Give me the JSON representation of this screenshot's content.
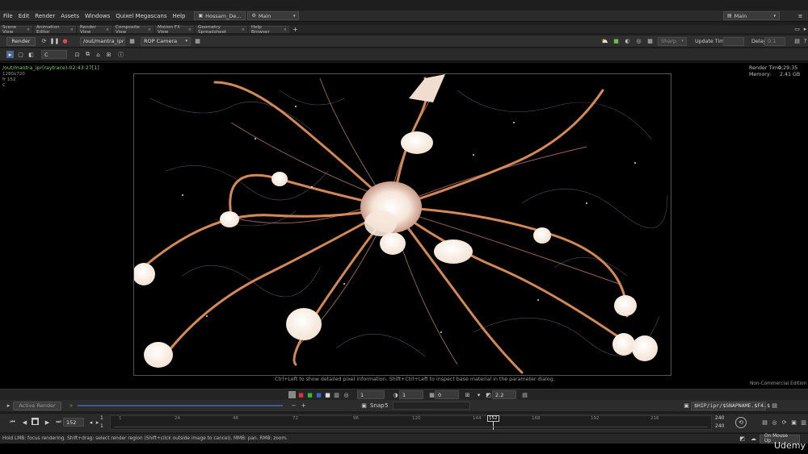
{
  "menu": [
    "File",
    "Edit",
    "Render",
    "Assets",
    "Windows",
    "Quixel Megascans",
    "Help"
  ],
  "desktop": {
    "file_name": "Hossam_De...",
    "desktop_name": "Main",
    "right_desktop": "Main"
  },
  "pane_tabs": [
    {
      "label": "Scene View",
      "active": false
    },
    {
      "label": "Animation Editor",
      "active": false
    },
    {
      "label": "Render View",
      "active": false
    },
    {
      "label": "Composite View",
      "active": false
    },
    {
      "label": "Motion FX View",
      "active": false
    },
    {
      "label": "Geometry Spreadsheet",
      "active": false
    },
    {
      "label": "Help Browser",
      "active": false
    }
  ],
  "render_toolbar": {
    "render_label": "Render",
    "rop_path": "/out/mantra_ipr",
    "camera": "ROP Camera",
    "sharp": "Sharp",
    "update_time": "Update Time",
    "delay": "Delay",
    "delay_value": "0.1"
  },
  "sub_toolbar": {
    "channel": "C"
  },
  "viewport": {
    "render_path": "/out/mantra_ipr(raytrace)-02:43:27[1]",
    "resolution": "1280x720",
    "frame_info": "fr 152",
    "channel_info": "C",
    "render_time_label": "Render Time:",
    "render_time": "0:29:35",
    "memory_label": "Memory:",
    "memory": "2.41 GB",
    "hint": "Ctrl+Left to show detailed pixel information. Shift+Ctrl+Left to inspect base material in the parameter dialog.",
    "edition": "Non-Commercial Edition"
  },
  "view_controls": {
    "field1": "1",
    "field2": "1",
    "field3": "0",
    "gamma": "2.2"
  },
  "status": {
    "active_render": "Active Render",
    "snap_label": "Snap",
    "snap_value": "5",
    "output_path": "$HIP/ipr/$SNAPNAME.$F4.$"
  },
  "timeline": {
    "current_frame": "152",
    "start": "1",
    "start2": "1",
    "ticks": [
      "1",
      "24",
      "48",
      "72",
      "96",
      "120",
      "144",
      "152",
      "168",
      "192",
      "216",
      "240"
    ],
    "end": "240",
    "end2": "240"
  },
  "help": "Hold LMB: focus rendering. Shift+drag: select render region (Shift+click outside image to cancel). MMB: pan. RMB: zoom.",
  "mouse_mode": "On Mouse Up",
  "watermark": "Udemy",
  "colors": {
    "accent_green": "#8fd35a",
    "timeline_bar": "#3a5a9a",
    "neuron_glow": "#fff4e8",
    "dendrite_orange": "#d8804a"
  }
}
